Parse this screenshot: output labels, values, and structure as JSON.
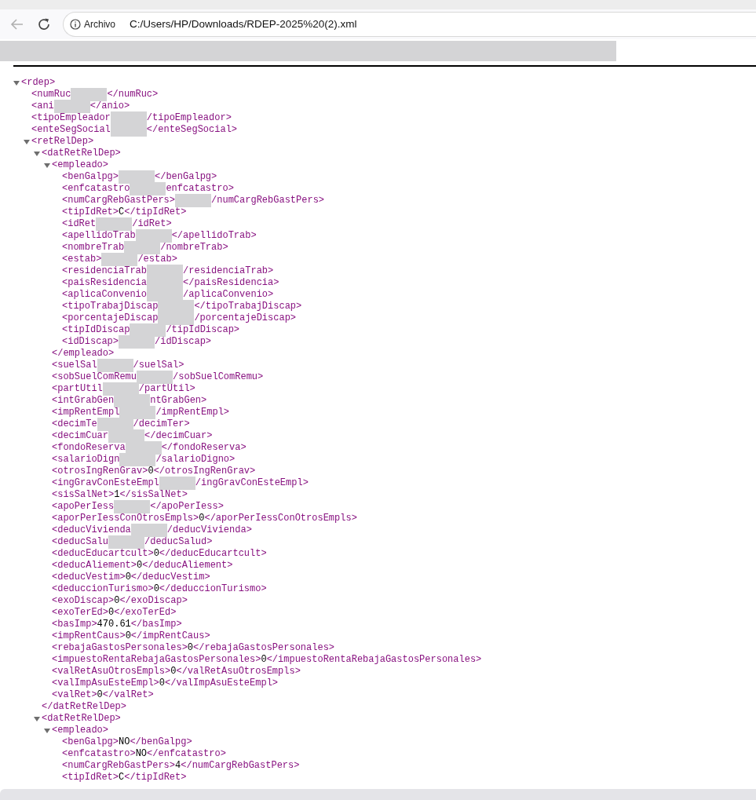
{
  "browser": {
    "address_label": "Archivo",
    "url": "C:/Users/HP/Downloads/RDEP-2025%20(2).xml"
  },
  "xml": {
    "kind": "node",
    "tag": "<rdep>",
    "expanded": true,
    "children": [
      {
        "kind": "redacted",
        "before": "<numRuc",
        "after": "</numRuc>"
      },
      {
        "kind": "redacted",
        "before": "<ani",
        "after": "</anio>"
      },
      {
        "kind": "redacted",
        "before": "<tipoEmpleador",
        "after": "/tipoEmpleador>"
      },
      {
        "kind": "redacted",
        "before": "<enteSegSocial",
        "after": "</enteSegSocial>"
      },
      {
        "kind": "node",
        "tag": "<retRelDep>",
        "expanded": true,
        "children": [
          {
            "kind": "node",
            "tag": "<datRetRelDep>",
            "expanded": true,
            "close": "</datRetRelDep>",
            "children": [
              {
                "kind": "node",
                "tag": "<empleado>",
                "expanded": true,
                "close": "</empleado>",
                "children": [
                  {
                    "kind": "redacted",
                    "before": "<benGalpg>",
                    "after": "</benGalpg>"
                  },
                  {
                    "kind": "redacted",
                    "before": "<enfcatastro",
                    "after": "enfcatastro>"
                  },
                  {
                    "kind": "redacted",
                    "before": "<numCargRebGastPers>",
                    "after": "/numCargRebGastPers>"
                  },
                  {
                    "kind": "element",
                    "open": "<tipIdRet>",
                    "value": "C",
                    "close": "</tipIdRet>"
                  },
                  {
                    "kind": "redacted",
                    "before": "<idRet",
                    "after": "/idRet>"
                  },
                  {
                    "kind": "redacted",
                    "before": "<apellidoTrab",
                    "after": "</apellidoTrab>"
                  },
                  {
                    "kind": "redacted",
                    "before": "<nombreTrab",
                    "after": "/nombreTrab>"
                  },
                  {
                    "kind": "redacted",
                    "before": "<estab>",
                    "after": "/estab>"
                  },
                  {
                    "kind": "redacted",
                    "before": "<residenciaTrab",
                    "after": "/residenciaTrab>"
                  },
                  {
                    "kind": "redacted",
                    "before": "<paisResidencia",
                    "after": "</paisResidencia>"
                  },
                  {
                    "kind": "redacted",
                    "before": "<aplicaConvenio",
                    "after": "/aplicaConvenio>"
                  },
                  {
                    "kind": "redacted",
                    "before": "<tipoTrabajDiscap",
                    "after": "</tipoTrabajDiscap>"
                  },
                  {
                    "kind": "redacted",
                    "before": "<porcentajeDiscap",
                    "after": "/porcentajeDiscap>"
                  },
                  {
                    "kind": "redacted",
                    "before": "<tipIdDiscap",
                    "after": "/tipIdDiscap>"
                  },
                  {
                    "kind": "redacted",
                    "before": "<idDiscap>",
                    "after": "/idDiscap>"
                  }
                ]
              },
              {
                "kind": "redacted",
                "before": "<suelSal",
                "after": "/suelSal>"
              },
              {
                "kind": "redacted",
                "before": "<sobSuelComRemu",
                "after": "/sobSuelComRemu>"
              },
              {
                "kind": "redacted",
                "before": "<partUtil",
                "after": "/partUtil>"
              },
              {
                "kind": "redacted",
                "before": "<intGrabGen",
                "after": "ntGrabGen>"
              },
              {
                "kind": "redacted",
                "before": "<impRentEmpl",
                "after": "/impRentEmpl>"
              },
              {
                "kind": "redacted",
                "before": "<decimTe",
                "after": "/decimTer>"
              },
              {
                "kind": "redacted",
                "before": "<decimCuar",
                "after": "</decimCuar>"
              },
              {
                "kind": "redacted",
                "before": "<fondoReserva",
                "after": "</fondoReserva>"
              },
              {
                "kind": "redacted",
                "before": "<salarioDign",
                "after": "/salarioDigno>"
              },
              {
                "kind": "element",
                "open": "<otrosIngRenGrav>",
                "value": "0",
                "close": "</otrosIngRenGrav>"
              },
              {
                "kind": "redacted",
                "before": "<ingGravConEsteEmpl",
                "after": "/ingGravConEsteEmpl>"
              },
              {
                "kind": "element",
                "open": "<sisSalNet>",
                "value": "1",
                "close": "</sisSalNet>"
              },
              {
                "kind": "redacted",
                "before": "<apoPerIess",
                "after": "</apoPerIess>"
              },
              {
                "kind": "element",
                "open": "<aporPerIessConOtrosEmpls>",
                "value": "0",
                "close": "</aporPerIessConOtrosEmpls>"
              },
              {
                "kind": "redacted",
                "before": "<deducVivienda",
                "after": "/deducVivienda>"
              },
              {
                "kind": "redacted",
                "before": "<deducSalu",
                "after": "/deducSalud>"
              },
              {
                "kind": "element",
                "open": "<deducEducartcult>",
                "value": "0",
                "close": "</deducEducartcult>"
              },
              {
                "kind": "element",
                "open": "<deducAliement>",
                "value": "0",
                "close": "</deducAliement>"
              },
              {
                "kind": "element",
                "open": "<deducVestim>",
                "value": "0",
                "close": "</deducVestim>"
              },
              {
                "kind": "element",
                "open": "<deduccionTurismo>",
                "value": "0",
                "close": "</deduccionTurismo>"
              },
              {
                "kind": "element",
                "open": "<exoDiscap>",
                "value": "0",
                "close": "</exoDiscap>"
              },
              {
                "kind": "element",
                "open": "<exoTerEd>",
                "value": "0",
                "close": "</exoTerEd>"
              },
              {
                "kind": "element",
                "open": "<basImp>",
                "value": "470.61",
                "close": "</basImp>"
              },
              {
                "kind": "element",
                "open": "<impRentCaus>",
                "value": "0",
                "close": "</impRentCaus>"
              },
              {
                "kind": "element",
                "open": "<rebajaGastosPersonales>",
                "value": "0",
                "close": "</rebajaGastosPersonales>"
              },
              {
                "kind": "element",
                "open": "<impuestoRentaRebajaGastosPersonales>",
                "value": "0",
                "close": "</impuestoRentaRebajaGastosPersonales>"
              },
              {
                "kind": "element",
                "open": "<valRetAsuOtrosEmpls>",
                "value": "0",
                "close": "</valRetAsuOtrosEmpls>"
              },
              {
                "kind": "element",
                "open": "<valImpAsuEsteEmpl>",
                "value": "0",
                "close": "</valImpAsuEsteEmpl>"
              },
              {
                "kind": "element",
                "open": "<valRet>",
                "value": "0",
                "close": "</valRet>"
              }
            ]
          },
          {
            "kind": "node",
            "tag": "<datRetRelDep>",
            "expanded": true,
            "children": [
              {
                "kind": "node",
                "tag": "<empleado>",
                "expanded": true,
                "children": [
                  {
                    "kind": "element",
                    "open": "<benGalpg>",
                    "value": "NO",
                    "close": "</benGalpg>"
                  },
                  {
                    "kind": "element",
                    "open": "<enfcatastro>",
                    "value": "NO",
                    "close": "</enfcatastro>"
                  },
                  {
                    "kind": "element",
                    "open": "<numCargRebGastPers>",
                    "value": "4",
                    "close": "</numCargRebGastPers>"
                  },
                  {
                    "kind": "element",
                    "open": "<tipIdRet>",
                    "value": "C",
                    "close": "</tipIdRet>"
                  }
                ]
              }
            ]
          }
        ]
      }
    ]
  }
}
